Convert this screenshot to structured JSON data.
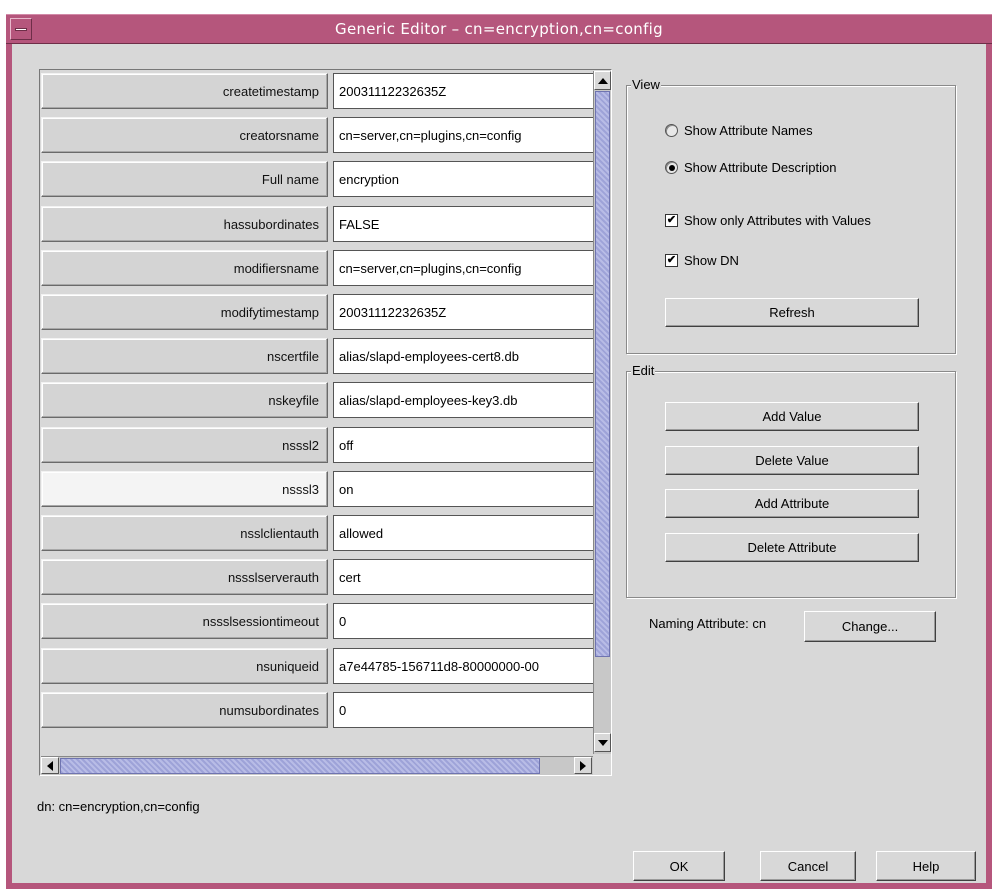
{
  "window": {
    "title": "Generic Editor – cn=encryption,cn=config"
  },
  "attributes": [
    {
      "name": "createtimestamp",
      "value": "20031112232635Z"
    },
    {
      "name": "creatorsname",
      "value": "cn=server,cn=plugins,cn=config"
    },
    {
      "name": "Full name",
      "value": "encryption"
    },
    {
      "name": "hassubordinates",
      "value": "FALSE"
    },
    {
      "name": "modifiersname",
      "value": "cn=server,cn=plugins,cn=config"
    },
    {
      "name": "modifytimestamp",
      "value": "20031112232635Z"
    },
    {
      "name": "nscertfile",
      "value": "alias/slapd-employees-cert8.db"
    },
    {
      "name": "nskeyfile",
      "value": "alias/slapd-employees-key3.db"
    },
    {
      "name": "nsssl2",
      "value": "off"
    },
    {
      "name": "nsssl3",
      "value": "on"
    },
    {
      "name": "nsslclientauth",
      "value": "allowed"
    },
    {
      "name": "nssslserverauth",
      "value": "cert"
    },
    {
      "name": "nssslsessiontimeout",
      "value": "0"
    },
    {
      "name": "nsuniqueid",
      "value": "a7e44785-156711d8-80000000-00"
    },
    {
      "name": "numsubordinates",
      "value": "0"
    }
  ],
  "selected_attribute": "nsssl3",
  "dn_text": "dn: cn=encryption,cn=config",
  "view_group": {
    "title": "View",
    "show_attribute_names": "Show Attribute Names",
    "show_attribute_description": "Show Attribute Description",
    "selected": "show_attribute_description",
    "show_only_with_values": "Show only Attributes with Values",
    "show_only_with_values_checked": true,
    "show_dn": "Show DN",
    "show_dn_checked": true,
    "refresh": "Refresh"
  },
  "edit_group": {
    "title": "Edit",
    "add_value": "Add Value",
    "delete_value": "Delete Value",
    "add_attribute": "Add Attribute",
    "delete_attribute": "Delete Attribute"
  },
  "naming": {
    "label": "Naming Attribute: cn",
    "change": "Change..."
  },
  "footer": {
    "ok": "OK",
    "cancel": "Cancel",
    "help": "Help"
  },
  "colors": {
    "titlebar": "#b5567c",
    "panel": "#d8d8d8",
    "scroll_thumb": "#9ea3d8"
  }
}
